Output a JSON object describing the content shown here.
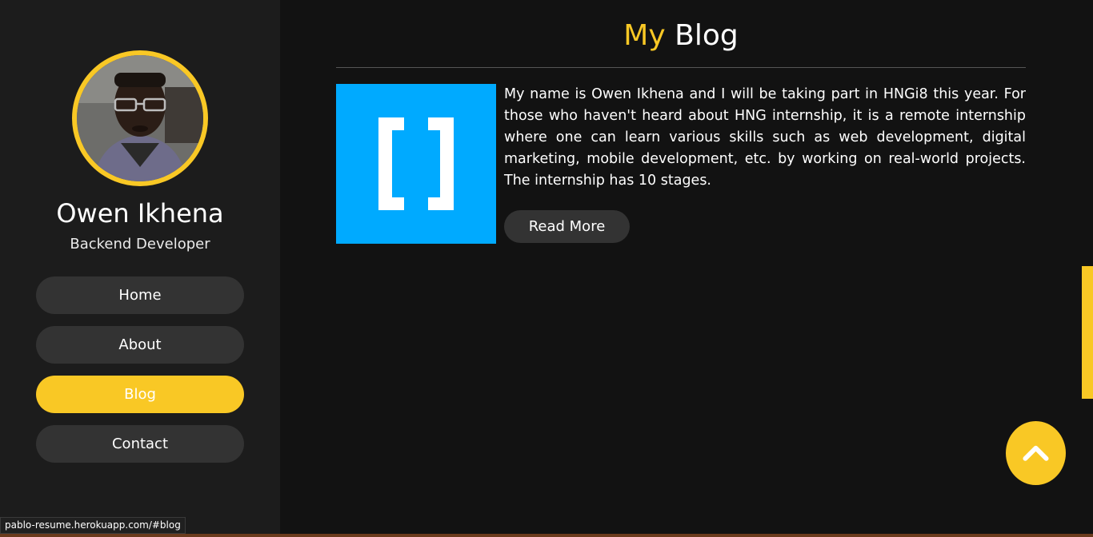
{
  "profile": {
    "name": "Owen Ikhena",
    "role": "Backend Developer"
  },
  "nav": {
    "items": [
      {
        "label": "Home",
        "active": false
      },
      {
        "label": "About",
        "active": false
      },
      {
        "label": "Blog",
        "active": true
      },
      {
        "label": "Contact",
        "active": false
      }
    ]
  },
  "section": {
    "title_accent": "My",
    "title_rest": "Blog"
  },
  "post": {
    "thumbnail_icon": "brackets-icon",
    "text": "My name is Owen Ikhena and I will be taking part in HNGi8 this year. For those who haven't heard about HNG internship, it is a remote internship where one can learn various skills such as web development, digital marketing, mobile development, etc. by working on real-world projects. The internship has 10 stages.",
    "read_more_label": "Read More"
  },
  "back_to_top": {
    "icon": "chevron-up-icon"
  },
  "status_bar": {
    "url": "pablo-resume.herokuapp.com/#blog"
  },
  "colors": {
    "accent": "#f9c825",
    "sidebar_bg": "#1c1c1c",
    "main_bg": "#121212",
    "button_bg": "#333333",
    "thumbnail_bg": "#00aaff"
  }
}
